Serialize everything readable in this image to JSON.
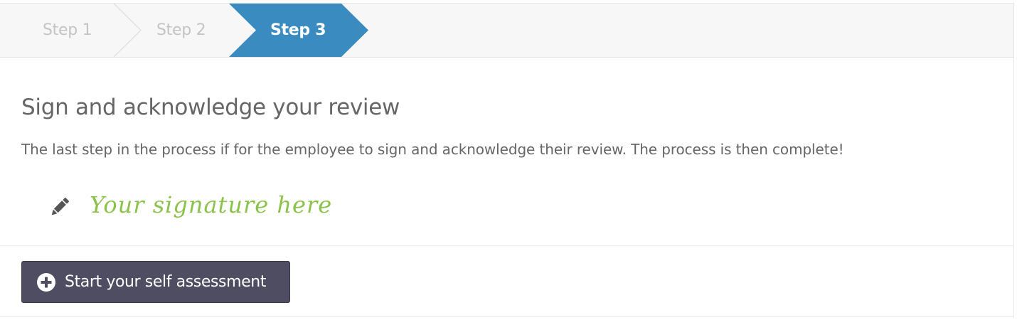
{
  "wizard": {
    "steps": [
      {
        "label": "Step 1",
        "state": "inactive"
      },
      {
        "label": "Step 2",
        "state": "inactive"
      },
      {
        "label": "Step 3",
        "state": "active"
      }
    ],
    "active_color": "#3a8cc0",
    "inactive_text_color": "#c4c4c4"
  },
  "content": {
    "title": "Sign and acknowledge your review",
    "description": "The last step in the process if for the employee to sign and acknowledge their review. The process is then complete!",
    "signature_placeholder": "Your signature here",
    "signature_color": "#8bc34a",
    "pencil_icon": "pencil-icon"
  },
  "actions": {
    "start_label": "Start your self assessment",
    "start_icon": "plus-circle-icon",
    "button_color": "#4e4d61"
  }
}
